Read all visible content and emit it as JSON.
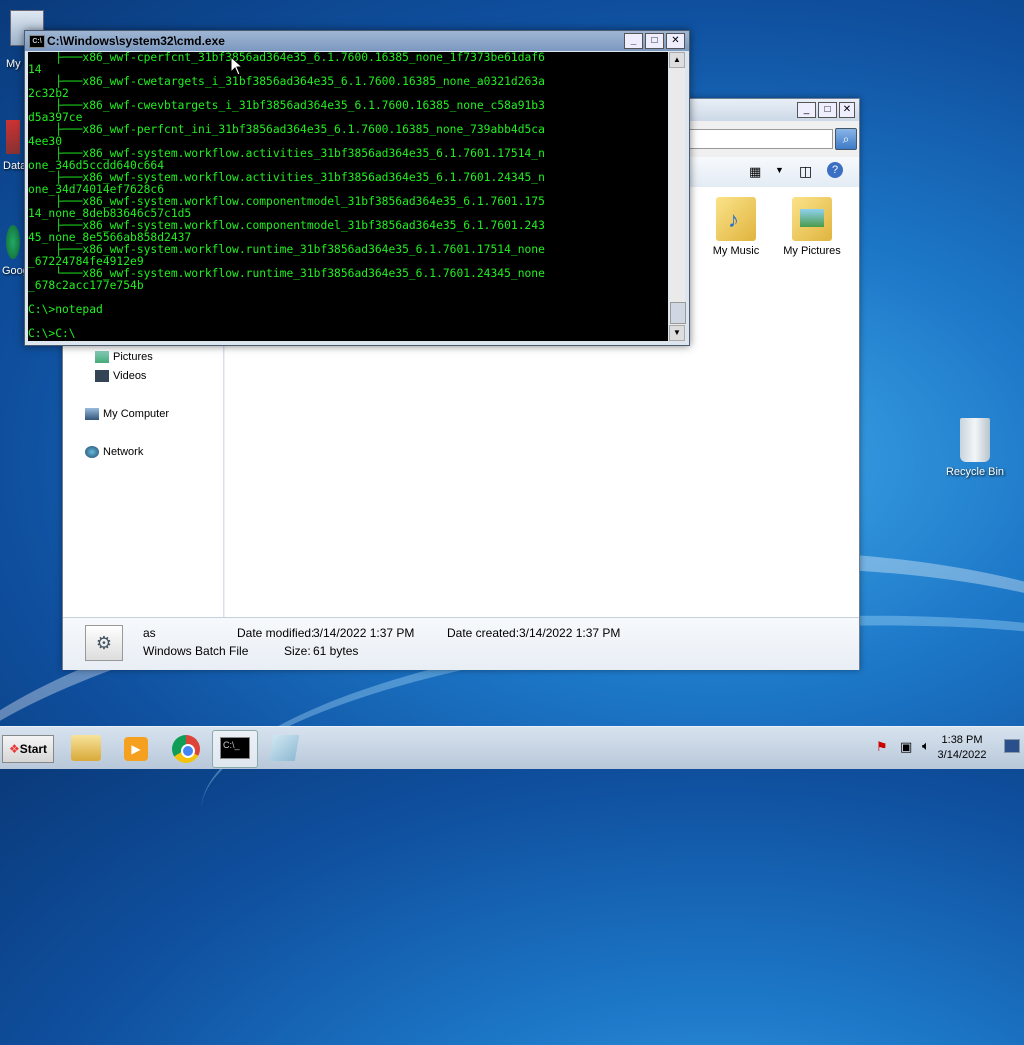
{
  "desktop": {
    "icons": [
      {
        "label": "My"
      },
      {
        "label": "Data"
      },
      {
        "label": "Goog"
      }
    ],
    "recycle_bin": "Recycle Bin"
  },
  "cmd": {
    "title": "C:\\Windows\\system32\\cmd.exe",
    "lines": [
      "    ├───x86_wwf-cperfcnt_31bf3856ad364e35_6.1.7600.16385_none_1f7373be61daf6",
      "14",
      "    ├───x86_wwf-cwetargets_i_31bf3856ad364e35_6.1.7600.16385_none_a0321d263a",
      "2c32b2",
      "    ├───x86_wwf-cwevbtargets_i_31bf3856ad364e35_6.1.7600.16385_none_c58a91b3",
      "d5a397ce",
      "    ├───x86_wwf-perfcnt_ini_31bf3856ad364e35_6.1.7600.16385_none_739abb4d5ca",
      "4ee30",
      "    ├───x86_wwf-system.workflow.activities_31bf3856ad364e35_6.1.7601.17514_n",
      "one_346d5ccdd640c664",
      "    ├───x86_wwf-system.workflow.activities_31bf3856ad364e35_6.1.7601.24345_n",
      "one_34d74014ef7628c6",
      "    ├───x86_wwf-system.workflow.componentmodel_31bf3856ad364e35_6.1.7601.175",
      "14_none_8deb83646c57c1d5",
      "    ├───x86_wwf-system.workflow.componentmodel_31bf3856ad364e35_6.1.7601.243",
      "45_none_8e5566ab858d2437",
      "    ├───x86_wwf-system.workflow.runtime_31bf3856ad364e35_6.1.7601.17514_none",
      "_67224784fe4912e9",
      "    └───x86_wwf-system.workflow.runtime_31bf3856ad364e35_6.1.7601.24345_none",
      "_678c2acc177e754b",
      "",
      "C:\\>notepad",
      "",
      "C:\\>C:\\"
    ]
  },
  "explorer": {
    "nav": [
      {
        "label": "Pictures"
      },
      {
        "label": "Videos"
      },
      {
        "label": "My Computer"
      },
      {
        "label": "Network"
      }
    ],
    "folders": [
      {
        "label": "My Music"
      },
      {
        "label": "My Pictures"
      }
    ],
    "details": {
      "name": "as",
      "type": "Windows Batch File",
      "modified_label": "Date modified:",
      "modified_value": "3/14/2022 1:37 PM",
      "created_label": "Date created:",
      "created_value": "3/14/2022 1:37 PM",
      "size_label": "Size:",
      "size_value": "61 bytes"
    }
  },
  "taskbar": {
    "start_label": "Start",
    "time": "1:38 PM",
    "date": "3/14/2022"
  }
}
